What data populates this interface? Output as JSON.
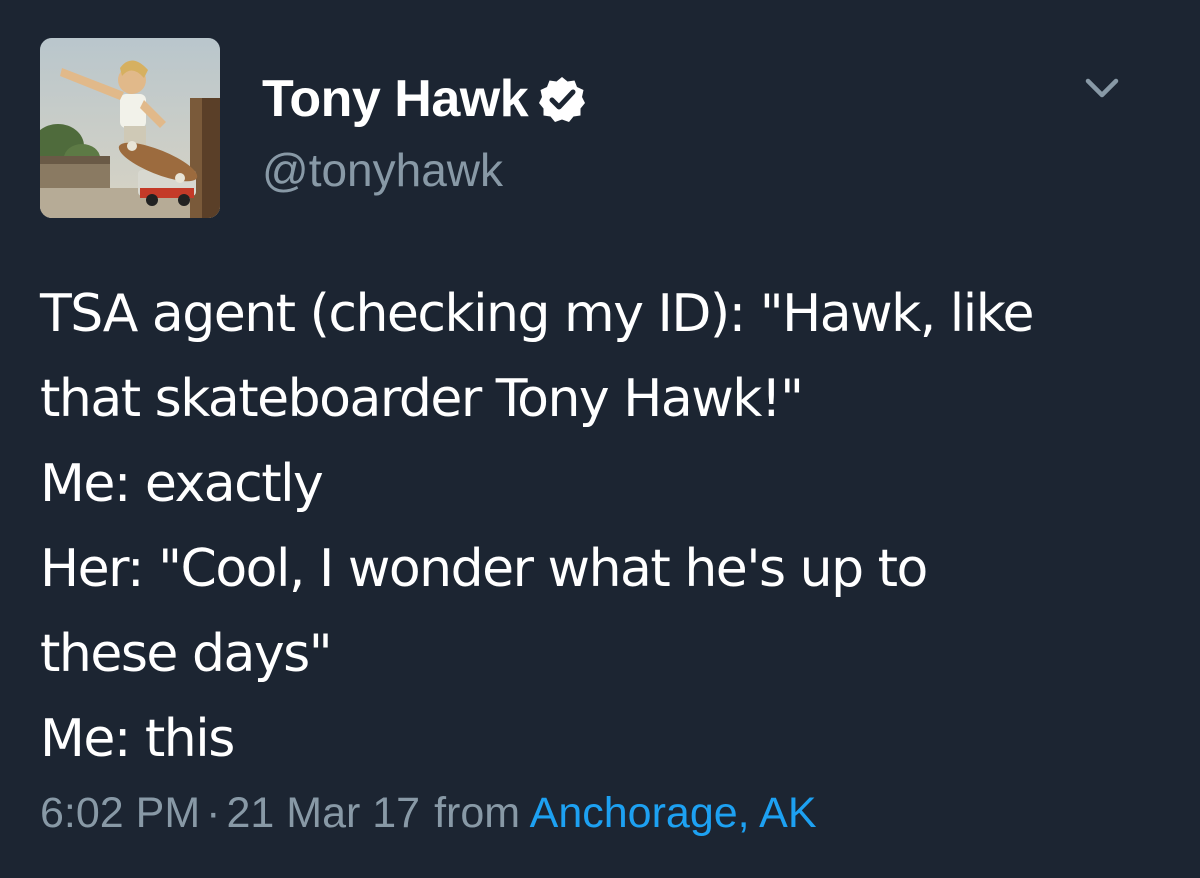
{
  "author": {
    "display_name": "Tony Hawk",
    "handle": "@tonyhawk",
    "verified": true,
    "avatar_icon": "skateboarder-photo"
  },
  "tweet": {
    "lines": [
      "TSA agent (checking my ID): \"Hawk, like",
      "that skateboarder Tony Hawk!\"",
      "Me: exactly",
      "Her: \"Cool, I wonder what he's up to",
      "these days\"",
      "Me: this"
    ]
  },
  "meta": {
    "time": "6:02 PM",
    "separator": "·",
    "date": "21 Mar 17",
    "from_label": "from",
    "location": "Anchorage, AK"
  },
  "icons": {
    "verified": "verified-badge-icon",
    "menu": "chevron-down-icon"
  },
  "colors": {
    "background": "#1c2532",
    "text": "#ffffff",
    "secondary": "#8899a6",
    "link": "#1da1f2"
  }
}
